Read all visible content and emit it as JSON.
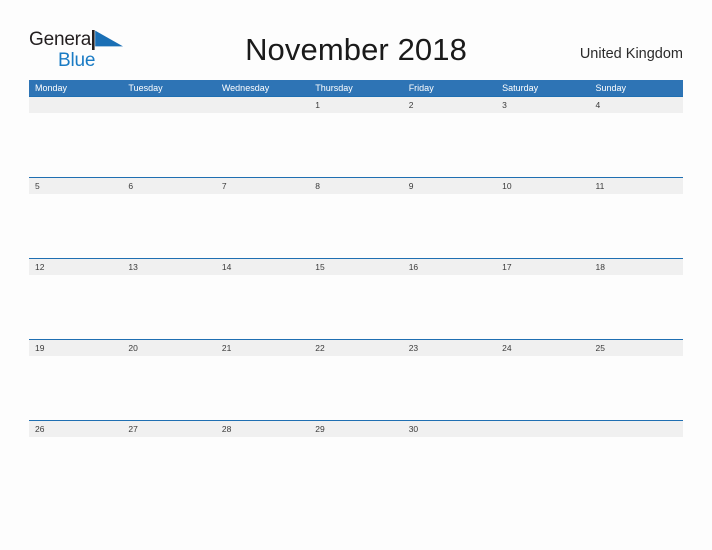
{
  "brand": {
    "name_part1": "General",
    "name_part2": "Blue",
    "flag_icon": "blue-triangle-flag",
    "color_dark": "#231f20",
    "color_blue": "#1a7bc4"
  },
  "header": {
    "title": "November 2018",
    "country": "United Kingdom"
  },
  "colors": {
    "header_blue": "#2e74b5",
    "row_divider_blue": "#1f6fb2",
    "day_band_gray": "#f0f0f0",
    "page_background": "#fdfdfd",
    "day_number_text": "#3a3a3a",
    "weekday_text": "#ffffff"
  },
  "calendar": {
    "month": "November",
    "year": "2018",
    "first_day_of_week": "Monday",
    "days_in_month": 30,
    "weekday_headers": [
      "Monday",
      "Tuesday",
      "Wednesday",
      "Thursday",
      "Friday",
      "Saturday",
      "Sunday"
    ],
    "weeks": [
      [
        "",
        "",
        "",
        "1",
        "2",
        "3",
        "4"
      ],
      [
        "5",
        "6",
        "7",
        "8",
        "9",
        "10",
        "11"
      ],
      [
        "12",
        "13",
        "14",
        "15",
        "16",
        "17",
        "18"
      ],
      [
        "19",
        "20",
        "21",
        "22",
        "23",
        "24",
        "25"
      ],
      [
        "26",
        "27",
        "28",
        "29",
        "30",
        "",
        ""
      ]
    ]
  }
}
